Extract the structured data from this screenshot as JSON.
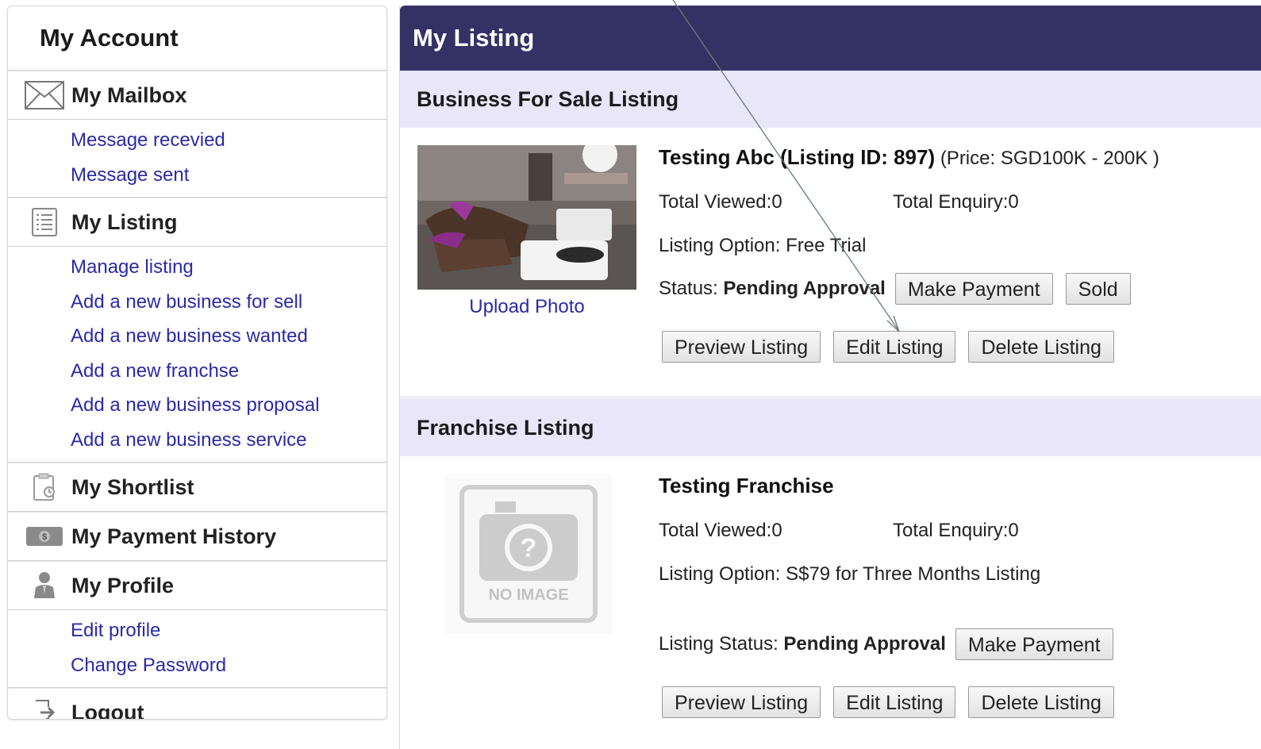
{
  "sidebar": {
    "title": "My Account",
    "mailbox": {
      "label": "My Mailbox",
      "icon": "envelope-icon",
      "links": [
        "Message recevied",
        "Message sent"
      ]
    },
    "listing": {
      "label": "My Listing",
      "icon": "list-icon",
      "links": [
        "Manage listing",
        "Add a new business for sell",
        "Add a new business wanted",
        "Add a new franchse",
        "Add a new business proposal",
        "Add a new business service"
      ]
    },
    "shortlist": {
      "label": "My Shortlist",
      "icon": "clipboard-icon"
    },
    "payment": {
      "label": "My Payment History",
      "icon": "money-icon"
    },
    "profile": {
      "label": "My Profile",
      "icon": "person-icon",
      "links": [
        "Edit profile",
        "Change Password"
      ]
    },
    "logout": {
      "label": "Logout",
      "icon": "logout-icon"
    }
  },
  "main": {
    "title": "My Listing",
    "business": {
      "section_title": "Business For Sale Listing",
      "name": "Testing Abc (Listing ID: 897)",
      "price": "(Price: SGD100K - 200K )",
      "viewed": "Total Viewed:0",
      "enquiry": "Total Enquiry:0",
      "option": "Listing Option: Free Trial",
      "status_label": "Status:",
      "status_value": "Pending Approval",
      "upload_label": "Upload Photo",
      "buttons": {
        "make_payment": "Make Payment",
        "sold": "Sold",
        "preview": "Preview Listing",
        "edit": "Edit Listing",
        "delete": "Delete Listing"
      }
    },
    "franchise": {
      "section_title": "Franchise Listing",
      "name": "Testing Franchise",
      "viewed": "Total Viewed:0",
      "enquiry": "Total Enquiry:0",
      "option": "Listing Option: S$79 for Three Months Listing",
      "status_label": "Listing Status:",
      "status_value": "Pending Approval",
      "no_image_text": "NO IMAGE",
      "buttons": {
        "make_payment": "Make Payment",
        "preview": "Preview Listing",
        "edit": "Edit Listing",
        "delete": "Delete Listing"
      }
    }
  },
  "colors": {
    "header_bg": "#343265",
    "section_bg": "#e8e6f8",
    "link": "#2a2aa6"
  }
}
